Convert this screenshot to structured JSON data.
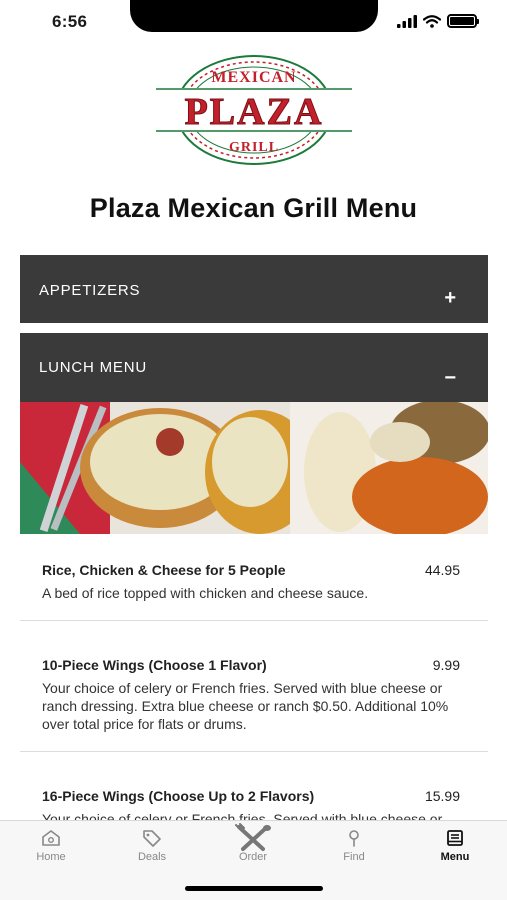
{
  "status_bar": {
    "time": "6:56"
  },
  "logo": {
    "top_text": "MEXICAN",
    "main_text": "PLAZA",
    "bottom_text": "GRILL"
  },
  "page_title": "Plaza Mexican Grill Menu",
  "sections": [
    {
      "label": "APPETIZERS",
      "toggle": "+",
      "expanded": false
    },
    {
      "label": "LUNCH MENU",
      "toggle": "−",
      "expanded": true
    }
  ],
  "menu_items": [
    {
      "name": "Rice, Chicken & Cheese for 5 People",
      "price": "44.95",
      "description": "A bed of rice topped with chicken and cheese sauce."
    },
    {
      "name": "10-Piece Wings (Choose 1 Flavor)",
      "price": "9.99",
      "description": "Your choice of celery or French fries. Served with blue cheese or ranch dressing. Extra blue cheese or ranch $0.50. Additional 10% over total price for flats or drums."
    },
    {
      "name": "16-Piece Wings (Choose Up to 2 Flavors)",
      "price": "15.99",
      "description": "Your choice of celery or French fries. Served with blue cheese or ranch dressing."
    }
  ],
  "tabs": [
    {
      "label": "Home",
      "icon": "home-icon",
      "active": false
    },
    {
      "label": "Deals",
      "icon": "tag-icon",
      "active": false
    },
    {
      "label": "Order",
      "icon": "utensils-icon",
      "active": false
    },
    {
      "label": "Find",
      "icon": "map-pin-icon",
      "active": false
    },
    {
      "label": "Menu",
      "icon": "menu-book-icon",
      "active": true
    }
  ],
  "colors": {
    "section_bg": "#3a3a3a",
    "logo_red": "#c4202b",
    "logo_green": "#1c7a3a"
  }
}
